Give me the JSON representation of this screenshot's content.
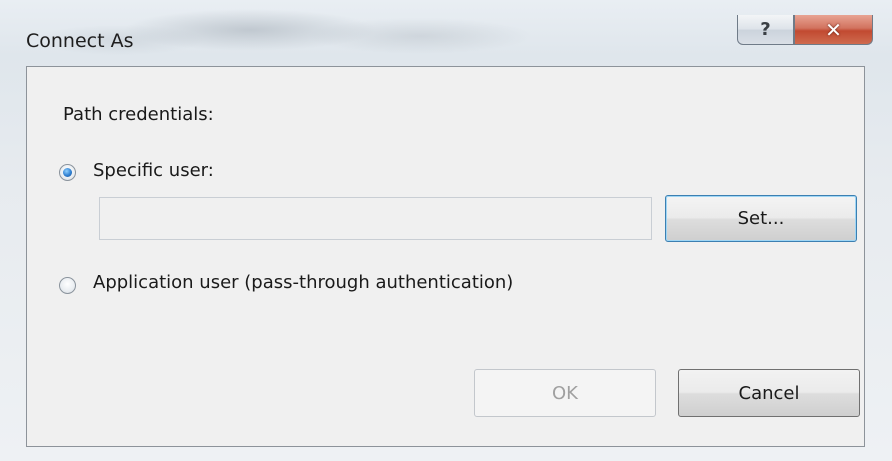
{
  "window": {
    "title": "Connect As",
    "help_glyph": "?",
    "close_glyph": "✕"
  },
  "dialog": {
    "group_label": "Path credentials:",
    "options": [
      {
        "label": "Specific user:",
        "checked": true
      },
      {
        "label": "Application user (pass-through authentication)",
        "checked": false
      }
    ],
    "user_field_value": "",
    "set_button_label": "Set...",
    "ok_button_label": "OK",
    "cancel_button_label": "Cancel"
  },
  "icons": {
    "help": "question-mark-icon",
    "close": "close-icon"
  }
}
